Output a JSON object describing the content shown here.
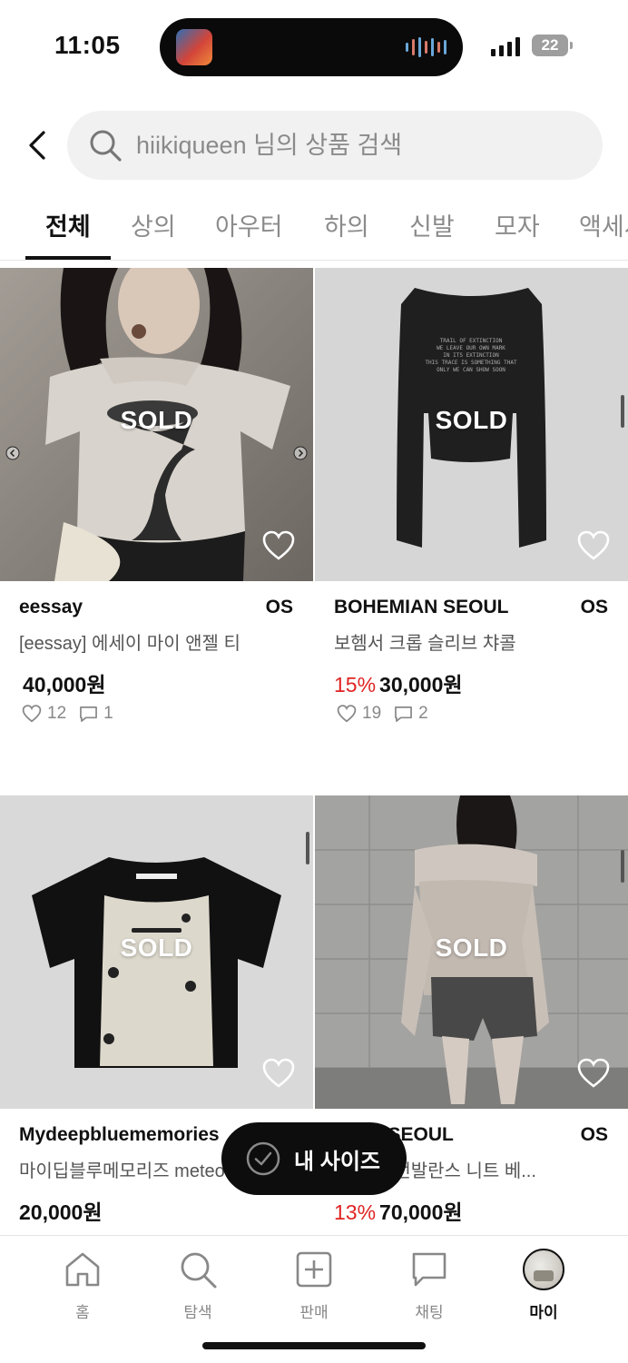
{
  "status_bar": {
    "time": "11:05",
    "battery": "22"
  },
  "search": {
    "placeholder": "hiikiqueen 님의 상품 검색"
  },
  "tabs": [
    {
      "label": "전체",
      "active": true
    },
    {
      "label": "상의",
      "active": false
    },
    {
      "label": "아우터",
      "active": false
    },
    {
      "label": "하의",
      "active": false
    },
    {
      "label": "신발",
      "active": false
    },
    {
      "label": "모자",
      "active": false
    },
    {
      "label": "액세서리",
      "active": false
    }
  ],
  "products": [
    {
      "brand": "eessay",
      "size": "OS",
      "name": "[eessay] 에세이 마이 앤젤 티",
      "discount": "",
      "price": "40,000원",
      "likes": "12",
      "comments": "1",
      "badge": "SOLD"
    },
    {
      "brand": "BOHEMIAN SEOUL",
      "size": "OS",
      "name": "보헴서 크롭 슬리브 챠콜",
      "discount": "15%",
      "price": "30,000원",
      "likes": "19",
      "comments": "2",
      "badge": "SOLD"
    },
    {
      "brand": "Mydeepbluememories",
      "size": "",
      "name": "마이딥블루메모리즈 meteor",
      "discount": "",
      "price": "20,000원",
      "likes": "",
      "comments": "",
      "badge": "SOLD"
    },
    {
      "brand": "MIAN SEOUL",
      "size": "OS",
      "name": "픈 카라 언발란스 니트 베...",
      "discount": "13%",
      "price": "70,000원",
      "likes": "",
      "comments": "",
      "badge": "SOLD"
    }
  ],
  "floating": {
    "my_size_label": "내 사이즈"
  },
  "bottom_nav": [
    {
      "label": "홈",
      "icon": "home-icon"
    },
    {
      "label": "탐색",
      "icon": "search-icon"
    },
    {
      "label": "판매",
      "icon": "plus-square-icon"
    },
    {
      "label": "채팅",
      "icon": "chat-icon"
    },
    {
      "label": "마이",
      "icon": "avatar",
      "active": true
    }
  ],
  "colors": {
    "discount": "#e02424",
    "pill": "#0d0d0d",
    "search_bg": "#f1f1f1"
  }
}
